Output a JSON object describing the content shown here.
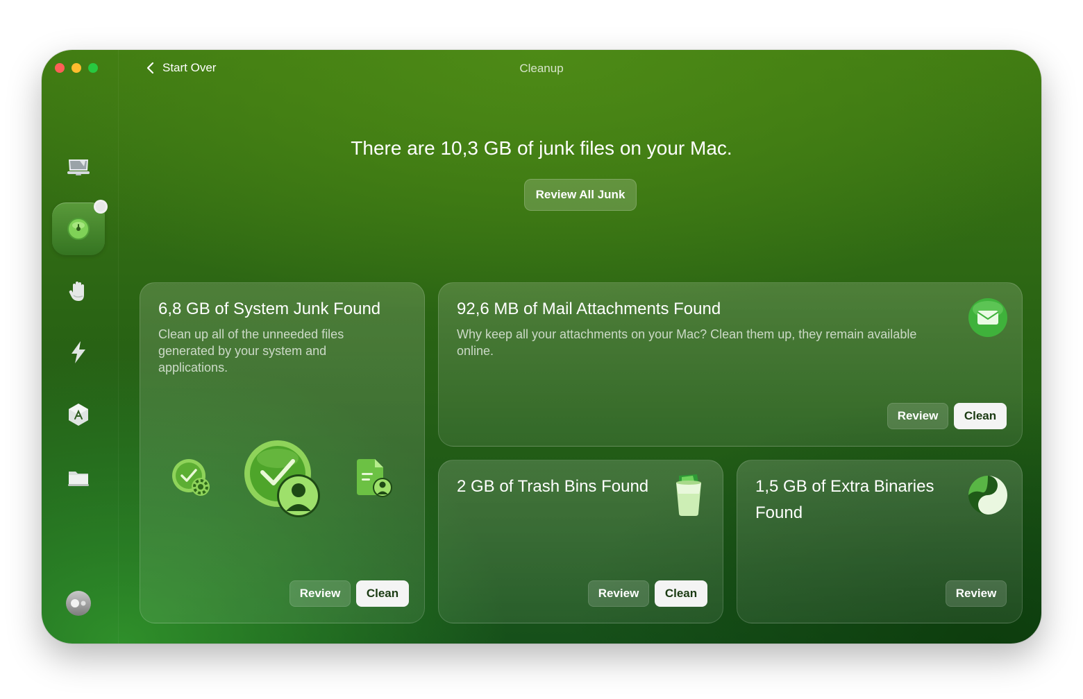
{
  "window": {
    "title": "Cleanup",
    "back_label": "Start Over"
  },
  "sidebar": {
    "items": [
      {
        "name": "smart-care",
        "icon": "monitor-icon"
      },
      {
        "name": "cleanup",
        "icon": "cleanup-disc-icon",
        "active": true
      },
      {
        "name": "protection",
        "icon": "hand-icon"
      },
      {
        "name": "performance",
        "icon": "lightning-icon"
      },
      {
        "name": "applications",
        "icon": "apps-icon"
      },
      {
        "name": "my-clutter",
        "icon": "folder-icon"
      }
    ],
    "assistant_icon": "assistant-icon"
  },
  "summary": {
    "headline": "There are 10,3 GB of junk files on your Mac.",
    "review_all_label": "Review All Junk"
  },
  "cards": {
    "system_junk": {
      "title": "6,8 GB of System Junk Found",
      "description": "Clean up all of the unneeded files generated by your system and applications.",
      "review_label": "Review",
      "clean_label": "Clean"
    },
    "mail": {
      "title": "92,6 MB of Mail Attachments Found",
      "description": "Why keep all your attachments on your Mac? Clean them up, they remain available online.",
      "review_label": "Review",
      "clean_label": "Clean"
    },
    "trash": {
      "title": "2 GB of Trash Bins Found",
      "review_label": "Review",
      "clean_label": "Clean"
    },
    "binaries": {
      "title": "1,5 GB of Extra Binaries Found",
      "review_label": "Review"
    }
  },
  "colors": {
    "accent_green": "#3f7a12",
    "clean_button_bg": "#f4f4f4",
    "mail_icon": "#3fb23b"
  }
}
